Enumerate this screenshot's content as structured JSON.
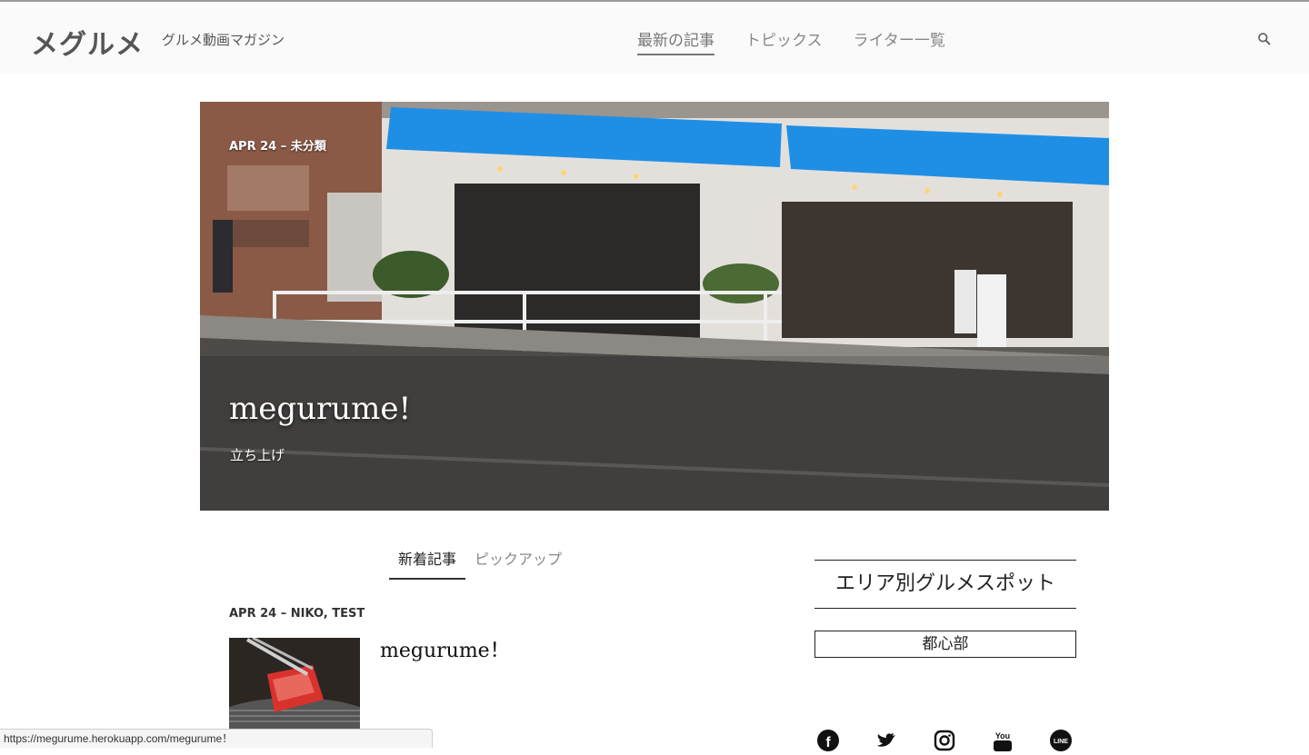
{
  "header": {
    "logo": "メグルメ",
    "tagline": "グルメ動画マガジン",
    "nav": [
      {
        "label": "最新の記事",
        "active": true
      },
      {
        "label": "トピックス",
        "active": false
      },
      {
        "label": "ライター一覧",
        "active": false
      }
    ],
    "search_icon": "search-icon"
  },
  "hero": {
    "meta": "APR 24 – 未分類",
    "title": "megurume!",
    "subtitle": "立ち上げ",
    "awning_color": "#1f8fe6"
  },
  "tabs": [
    {
      "label": "新着記事",
      "active": true
    },
    {
      "label": "ピックアップ",
      "active": false
    }
  ],
  "article": {
    "meta": "APR 24 – NIKO, TEST",
    "title": "megurume！"
  },
  "sidebar": {
    "heading": "エリア別グルメスポット",
    "areas": [
      "都心部"
    ]
  },
  "social_icons": [
    "facebook-icon",
    "twitter-icon",
    "instagram-icon",
    "youtube-icon",
    "line-icon"
  ],
  "status_url": "https://megurume.herokuapp.com/megurume！"
}
